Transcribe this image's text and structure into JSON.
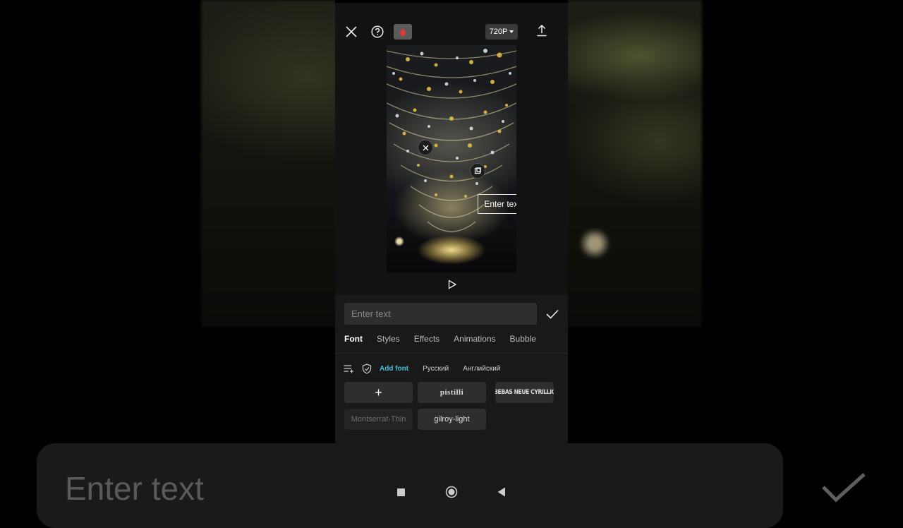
{
  "background": {
    "text_placeholder": "Enter text"
  },
  "header": {
    "resolution_label": "720P"
  },
  "preview": {
    "overlay_text": "Enter text"
  },
  "editor": {
    "input_placeholder": "Enter text",
    "tabs": [
      "Font",
      "Styles",
      "Effects",
      "Animations",
      "Bubble"
    ],
    "active_tab": "Font",
    "subtoolbar": {
      "add_font": "Add font",
      "russian": "Русский",
      "english": "Английский"
    },
    "fonts": {
      "add": "+",
      "f1": "pistilli",
      "f2": "BEBAS NEUE CYRILLIC",
      "f3": "Montserrat-Thin",
      "f4": "gilroy-light"
    }
  },
  "colors": {
    "accent": "#3fc0d8",
    "pro_badge": "#e53935"
  }
}
